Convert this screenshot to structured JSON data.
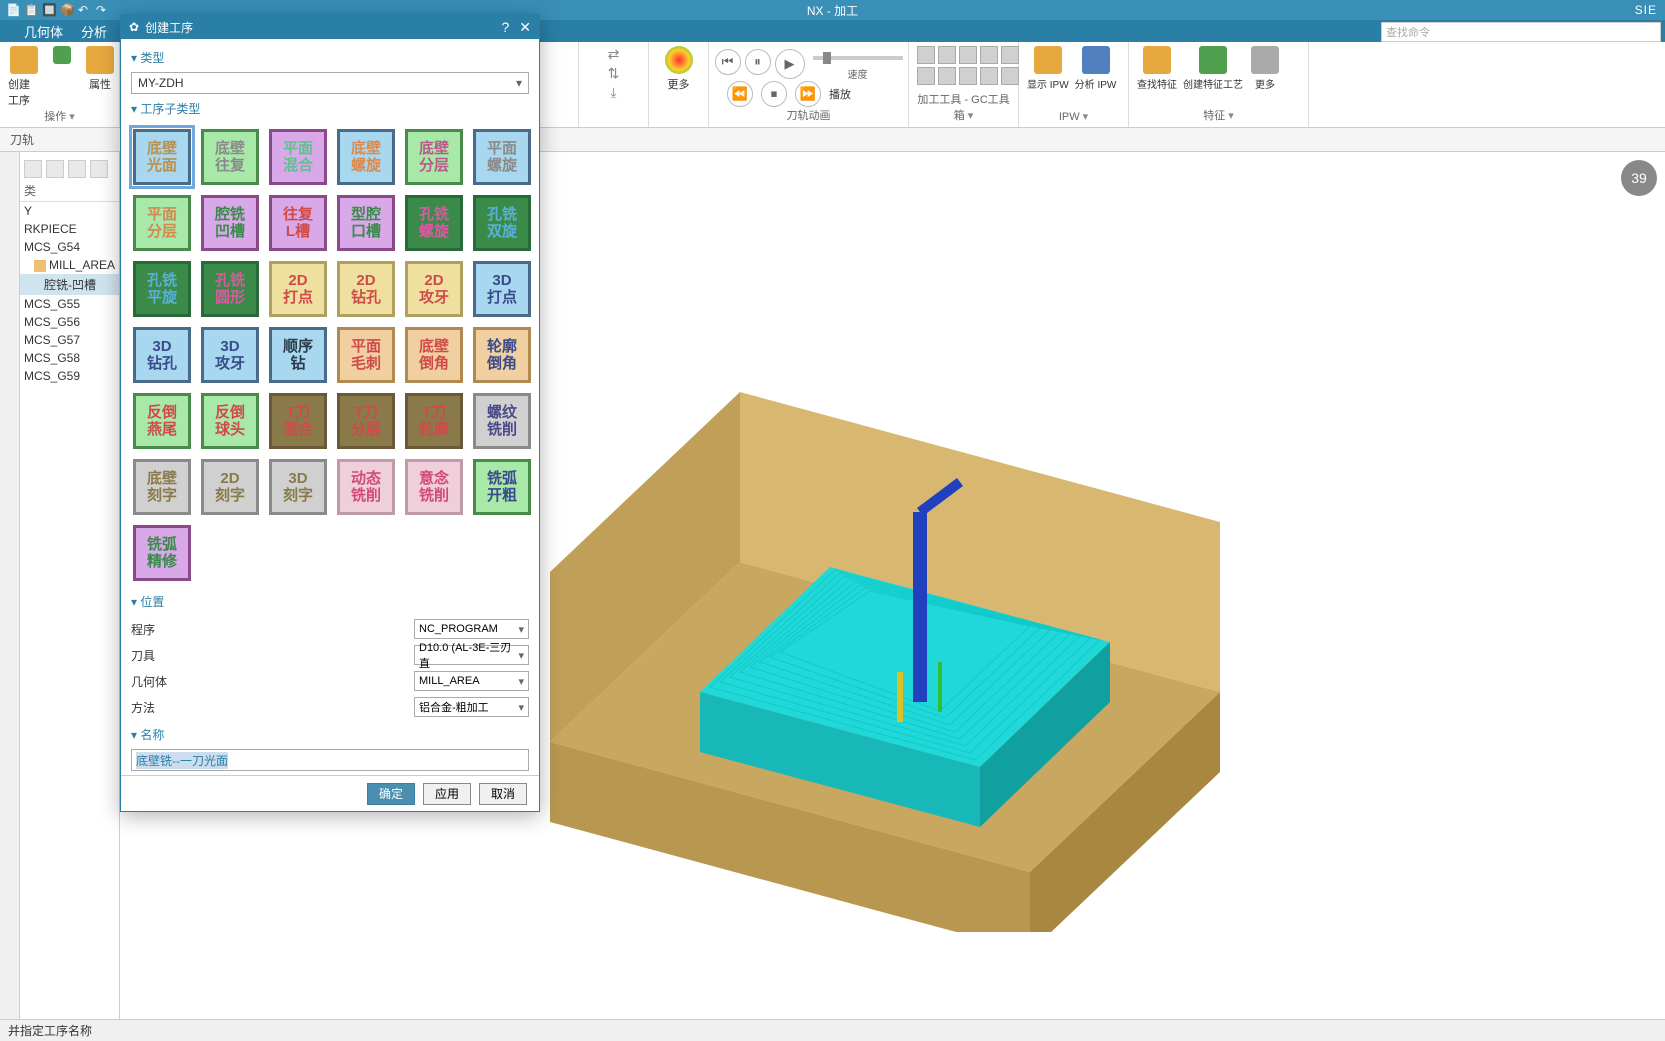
{
  "title_bar": {
    "app_title": "NX - 加工",
    "brand": "SIE"
  },
  "menu_tabs": [
    "几何体",
    "分析"
  ],
  "search_placeholder": "查找命令",
  "ribbon": {
    "g1": {
      "create_op": "创建工序",
      "props": "属性",
      "ops_label": "操作"
    },
    "g2": {
      "more": "更多"
    },
    "g3": {
      "play": "播放",
      "speed": "速度"
    },
    "g4": {
      "label": "刀轨动画"
    },
    "g5": {
      "label": "加工工具 - GC工具箱"
    },
    "g6": {
      "show_ipw": "显示 IPW",
      "analyze_ipw": "分析 IPW",
      "label": "IPW"
    },
    "g7": {
      "find_feat": "查找特征",
      "create_feat": "创建特征工艺",
      "more": "更多",
      "label": "特征"
    }
  },
  "tab_strip": {
    "tool_path": "刀轨"
  },
  "tree": {
    "header": "类",
    "nodes": [
      {
        "t": "Y"
      },
      {
        "t": "RKPIECE"
      },
      {
        "t": "MCS_G54"
      },
      {
        "t": "MILL_AREA",
        "ic": true,
        "indent": 1
      },
      {
        "t": "腔铣-凹槽",
        "sel": true,
        "indent": 2
      },
      {
        "t": "MCS_G55"
      },
      {
        "t": "MCS_G56"
      },
      {
        "t": "MCS_G57"
      },
      {
        "t": "MCS_G58"
      },
      {
        "t": "MCS_G59"
      }
    ]
  },
  "dialog": {
    "title": "创建工序",
    "sections": {
      "type": "类型",
      "subtype": "工序子类型",
      "location": "位置",
      "name": "名称"
    },
    "type_value": "MY-ZDH",
    "subtypes": [
      {
        "t": "底壁\n光面",
        "bg": "#a8d8f0",
        "fg": "#b89050",
        "bd": "#4a6a8a",
        "sel": true
      },
      {
        "t": "底壁\n往复",
        "bg": "#a8e8a8",
        "fg": "#8a8a8a",
        "bd": "#4a8a4a"
      },
      {
        "t": "平面\n混合",
        "bg": "#d8a8e8",
        "fg": "#60c090",
        "bd": "#8a4a8a"
      },
      {
        "t": "底壁\n螺旋",
        "bg": "#a8d8f0",
        "fg": "#d88a50",
        "bd": "#4a6a8a"
      },
      {
        "t": "底壁\n分层",
        "bg": "#a8e8a8",
        "fg": "#b85a8a",
        "bd": "#4a8a4a"
      },
      {
        "t": "平面\n螺旋",
        "bg": "#a8d8f0",
        "fg": "#8a8a8a",
        "bd": "#4a6a8a"
      },
      {
        "t": "平面\n分层",
        "bg": "#a8e8a8",
        "fg": "#d08a50",
        "bd": "#4a8a4a"
      },
      {
        "t": "腔铣\n凹槽",
        "bg": "#d8a8e8",
        "fg": "#3a8a4a",
        "bd": "#8a4a8a"
      },
      {
        "t": "往复\nL槽",
        "bg": "#d8a8e8",
        "fg": "#d04a4a",
        "bd": "#8a4a8a"
      },
      {
        "t": "型腔\n口槽",
        "bg": "#d8a8e8",
        "fg": "#3a8a4a",
        "bd": "#8a4a8a"
      },
      {
        "t": "孔铣\n螺旋",
        "bg": "#3a8a4a",
        "fg": "#d85aa0",
        "bd": "#2a6a3a"
      },
      {
        "t": "孔铣\n双旋",
        "bg": "#3a8a4a",
        "fg": "#5ab0d8",
        "bd": "#2a6a3a"
      },
      {
        "t": "孔铣\n平旋",
        "bg": "#3a8a4a",
        "fg": "#5ab0d8",
        "bd": "#2a6a3a"
      },
      {
        "t": "孔铣\n圆形",
        "bg": "#3a8a4a",
        "fg": "#d85aa0",
        "bd": "#2a6a3a"
      },
      {
        "t": "2D\n打点",
        "bg": "#f0e0a0",
        "fg": "#d04a4a",
        "bd": "#b0a060"
      },
      {
        "t": "2D\n钻孔",
        "bg": "#f0e0a0",
        "fg": "#d04a4a",
        "bd": "#b0a060"
      },
      {
        "t": "2D\n攻牙",
        "bg": "#f0e0a0",
        "fg": "#d04a4a",
        "bd": "#b0a060"
      },
      {
        "t": "3D\n打点",
        "bg": "#a8d8f0",
        "fg": "#3a4a8a",
        "bd": "#4a6a8a"
      },
      {
        "t": "3D\n钻孔",
        "bg": "#a8d8f0",
        "fg": "#3a4a8a",
        "bd": "#4a6a8a"
      },
      {
        "t": "3D\n攻牙",
        "bg": "#a8d8f0",
        "fg": "#3a4a8a",
        "bd": "#4a6a8a"
      },
      {
        "t": "顺序\n钻",
        "bg": "#a8d8f0",
        "fg": "#2a3a4a",
        "bd": "#4a6a8a"
      },
      {
        "t": "平面\n毛刺",
        "bg": "#f0d0a0",
        "fg": "#d04a4a",
        "bd": "#b08a50"
      },
      {
        "t": "底壁\n倒角",
        "bg": "#f0d0a0",
        "fg": "#d04a4a",
        "bd": "#b08a50"
      },
      {
        "t": "轮廓\n倒角",
        "bg": "#f0d0a0",
        "fg": "#3a4a8a",
        "bd": "#b08a50"
      },
      {
        "t": "反倒\n燕尾",
        "bg": "#a8e8a8",
        "fg": "#d04a4a",
        "bd": "#4a8a4a"
      },
      {
        "t": "反倒\n球头",
        "bg": "#a8e8a8",
        "fg": "#d04a4a",
        "bd": "#4a8a4a"
      },
      {
        "t": "T刀\n混合",
        "bg": "#8a7a4a",
        "fg": "#d04a4a",
        "bd": "#6a5a3a"
      },
      {
        "t": "T刀\n分层",
        "bg": "#8a7a4a",
        "fg": "#d04a4a",
        "bd": "#6a5a3a"
      },
      {
        "t": "T刀\n轮廓",
        "bg": "#8a7a4a",
        "fg": "#d04a4a",
        "bd": "#6a5a3a"
      },
      {
        "t": "螺纹\n铣削",
        "bg": "#d0d0d0",
        "fg": "#4a4a8a",
        "bd": "#8a8a8a"
      },
      {
        "t": "底壁\n刻字",
        "bg": "#d0d0d0",
        "fg": "#8a7a4a",
        "bd": "#8a8a8a"
      },
      {
        "t": "2D\n刻字",
        "bg": "#d0d0d0",
        "fg": "#8a7a4a",
        "bd": "#8a8a8a"
      },
      {
        "t": "3D\n刻字",
        "bg": "#d0d0d0",
        "fg": "#8a7a4a",
        "bd": "#8a8a8a"
      },
      {
        "t": "动态\n铣削",
        "bg": "#f0d0d8",
        "fg": "#d04a7a",
        "bd": "#c09aa8"
      },
      {
        "t": "意念\n铣削",
        "bg": "#f0d0d8",
        "fg": "#d04a7a",
        "bd": "#c09aa8"
      },
      {
        "t": "铣弧\n开粗",
        "bg": "#a8e8a8",
        "fg": "#3a4a8a",
        "bd": "#4a8a4a"
      },
      {
        "t": "铣弧\n精修",
        "bg": "#d8a8e8",
        "fg": "#3a8a4a",
        "bd": "#8a4a8a"
      }
    ],
    "location": {
      "program_label": "程序",
      "program_value": "NC_PROGRAM",
      "tool_label": "刀具",
      "tool_value": "D10.0 (AL-3E-三刃直",
      "geom_label": "几何体",
      "geom_value": "MILL_AREA",
      "method_label": "方法",
      "method_value": "铝合金-粗加工"
    },
    "name_value": "底壁铣--一刀光面",
    "buttons": {
      "ok": "确定",
      "apply": "应用",
      "cancel": "取消"
    }
  },
  "viewport": {
    "badge": "39"
  },
  "status": "并指定工序名称"
}
